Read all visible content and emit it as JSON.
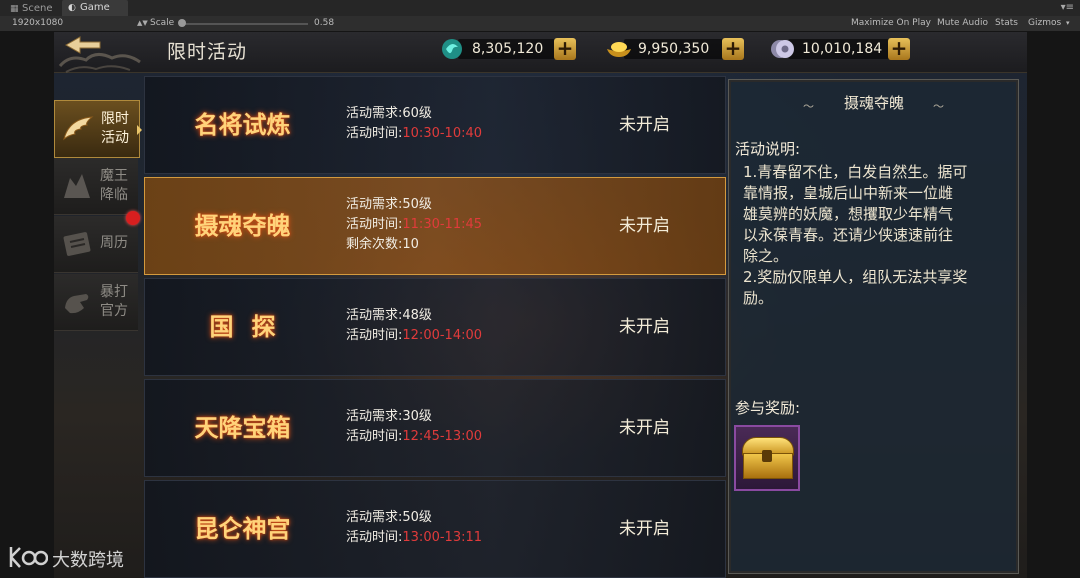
{
  "editor": {
    "tabs": [
      {
        "label": "Scene",
        "icon": "grid-icon"
      },
      {
        "label": "Game",
        "icon": "pacman-icon"
      }
    ],
    "resolution": "1920x1080",
    "scale_label": "Scale",
    "scale_value": "0.58",
    "buttons": {
      "maximize": "Maximize On Play",
      "mute": "Mute Audio",
      "stats": "Stats",
      "gizmos": "Gizmos"
    }
  },
  "game": {
    "title": "限时活动",
    "currencies": [
      {
        "name": "jade",
        "icon": "jade-icon",
        "value": "8,305,120",
        "color": "#3fd6c8"
      },
      {
        "name": "gold",
        "icon": "gold-ingot-icon",
        "value": "9,950,350",
        "color": "#e8b22a"
      },
      {
        "name": "silver",
        "icon": "silver-coin-icon",
        "value": "10,010,184",
        "color": "#b9b4d6"
      }
    ],
    "side_tabs": [
      {
        "label_line1": "限时",
        "label_line2": "活动",
        "icon": "wing-icon",
        "active": true
      },
      {
        "label_line1": "魔王",
        "label_line2": "降临",
        "icon": "demon-icon",
        "active": false
      },
      {
        "label_line1": "周历",
        "label_line2": "",
        "icon": "calendar-icon",
        "active": false,
        "notification": true
      },
      {
        "label_line1": "暴打",
        "label_line2": "官方",
        "icon": "fist-icon",
        "active": false
      }
    ],
    "events": [
      {
        "name": "名将试炼",
        "req": "活动需求:60级",
        "time_label": "活动时间:",
        "time": "10:30-10:40",
        "extra": "",
        "status": "未开启"
      },
      {
        "name": "摄魂夺魄",
        "req": "活动需求:50级",
        "time_label": "活动时间:",
        "time": "11:30-11:45",
        "extra": "剩余次数:10",
        "status": "未开启",
        "selected": true
      },
      {
        "name": "国探",
        "req": "活动需求:48级",
        "time_label": "活动时间:",
        "time": "12:00-14:00",
        "extra": "",
        "status": "未开启"
      },
      {
        "name": "天降宝箱",
        "req": "活动需求:30级",
        "time_label": "活动时间:",
        "time": "12:45-13:00",
        "extra": "",
        "status": "未开启"
      },
      {
        "name": "昆仑神宫",
        "req": "活动需求:50级",
        "time_label": "活动时间:",
        "time": "13:00-13:11",
        "extra": "",
        "status": "未开启"
      }
    ],
    "info": {
      "title": "摄魂夺魄",
      "desc_heading": "活动说明:",
      "desc_lines": [
        "1.青春留不住，白发自然生。据可",
        "靠情报，皇城后山中新来一位雌",
        "雄莫辨的妖魔，想攫取少年精气",
        "以永葆青春。还请少侠速速前往",
        "除之。",
        "2.奖励仅限单人，组队无法共享奖",
        "励。"
      ],
      "reward_heading": "参与奖励:",
      "reward_icon": "treasure-chest-icon"
    }
  },
  "watermark": {
    "text": "大数跨境",
    "icon": "kbo-logo-icon"
  }
}
